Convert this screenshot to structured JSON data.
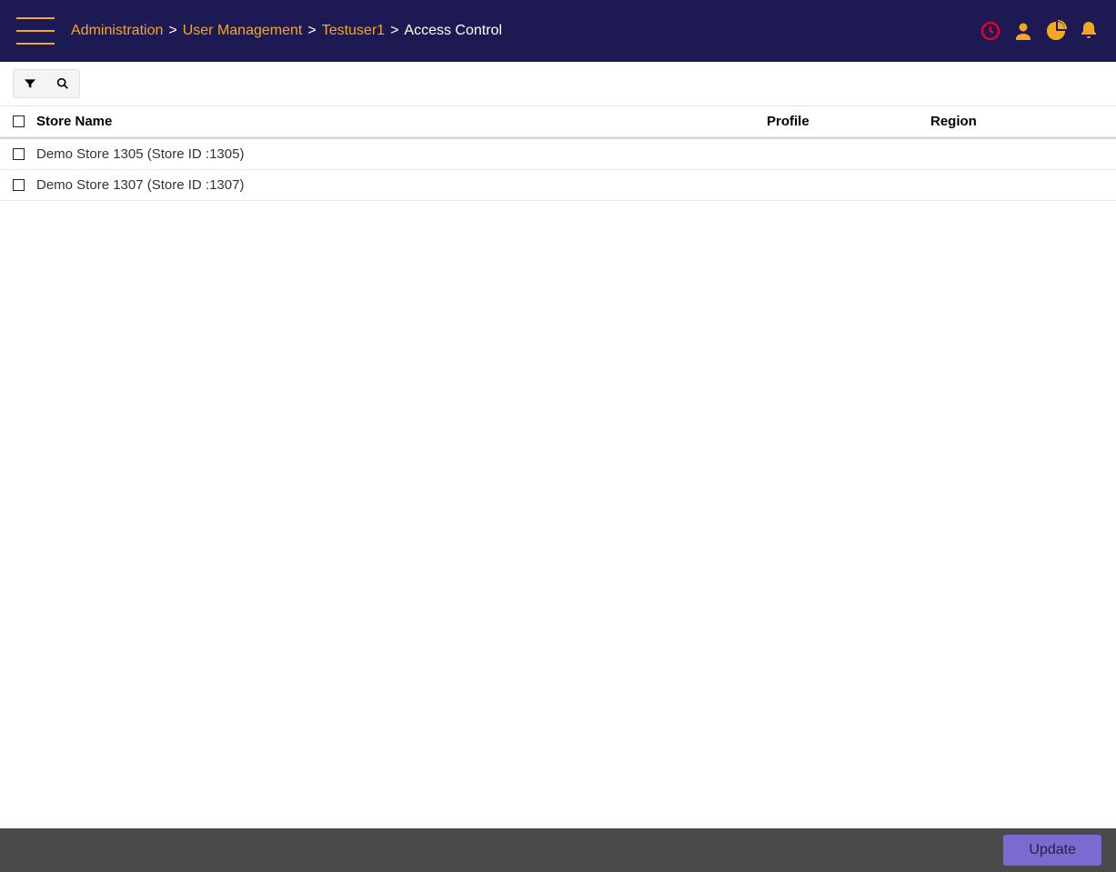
{
  "breadcrumb": {
    "items": [
      {
        "label": "Administration",
        "link": true
      },
      {
        "label": "User Management",
        "link": true
      },
      {
        "label": "Testuser1",
        "link": true
      },
      {
        "label": "Access Control",
        "link": false
      }
    ],
    "separator": ">"
  },
  "header_icons": {
    "clock": "clock-icon",
    "user": "user-icon",
    "chart": "pie-chart-icon",
    "bell": "bell-icon"
  },
  "columns": {
    "store": "Store Name",
    "profile": "Profile",
    "region": "Region"
  },
  "rows": [
    {
      "store": "Demo Store 1305 (Store ID :1305)",
      "profile": "",
      "region": ""
    },
    {
      "store": "Demo Store 1307 (Store ID :1307)",
      "profile": "",
      "region": ""
    }
  ],
  "footer": {
    "update_label": "Update"
  },
  "colors": {
    "header_bg": "#1d1a53",
    "accent": "#f5a623",
    "clock_icon": "#e4002b",
    "update_btn": "#7b6bd1"
  }
}
